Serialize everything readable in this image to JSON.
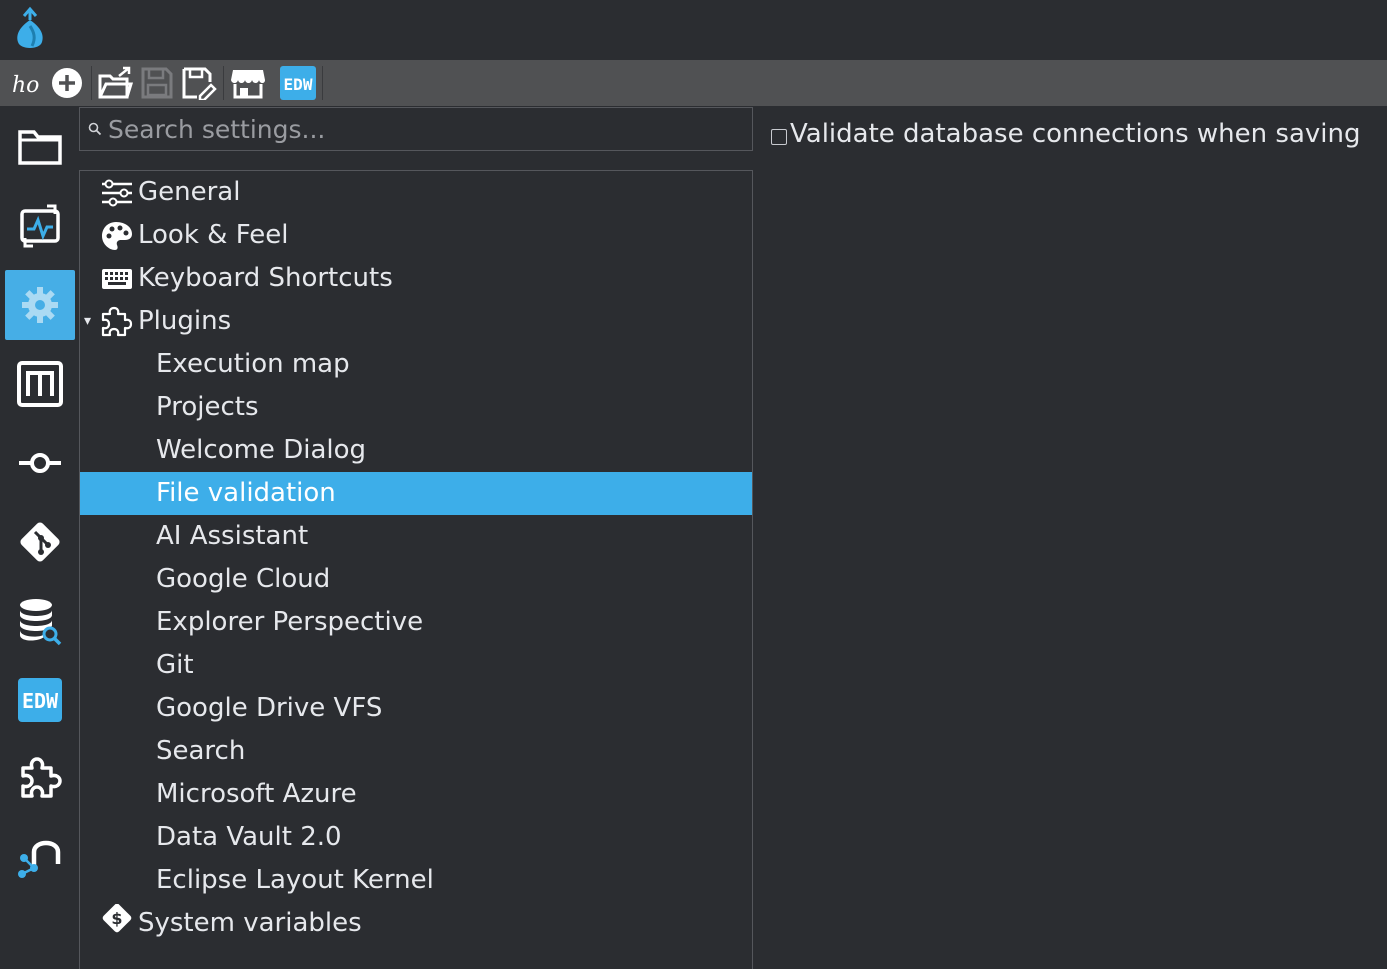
{
  "app": {
    "logo_icon": "hop-logo-icon"
  },
  "toolbar": {
    "buttons": [
      {
        "name": "hop-icon"
      },
      {
        "name": "new-icon"
      },
      {
        "name": "open-file-icon"
      },
      {
        "name": "save-icon"
      },
      {
        "name": "save-as-icon"
      },
      {
        "name": "marketplace-icon"
      },
      {
        "name": "edw-icon",
        "text": "EDW"
      }
    ]
  },
  "sidebar": {
    "items": [
      {
        "name": "file-explorer",
        "icon": "folder-icon"
      },
      {
        "name": "execution-perspective",
        "icon": "execution-chart-icon"
      },
      {
        "name": "configuration",
        "icon": "gear-icon",
        "active": true
      },
      {
        "name": "metadata",
        "icon": "metadata-icon"
      },
      {
        "name": "pipeline",
        "icon": "pipeline-node-icon"
      },
      {
        "name": "git",
        "icon": "git-icon"
      },
      {
        "name": "database-search",
        "icon": "database-search-icon"
      },
      {
        "name": "edw",
        "icon": "edw-icon",
        "text": "EDW"
      },
      {
        "name": "plugins",
        "icon": "puzzle-icon"
      },
      {
        "name": "neo4j",
        "icon": "neo4j-icon"
      }
    ]
  },
  "search": {
    "placeholder": "Search settings...",
    "value": ""
  },
  "tree": {
    "items": [
      {
        "label": "General",
        "icon": "sliders-icon",
        "level": 0
      },
      {
        "label": "Look & Feel",
        "icon": "palette-icon",
        "level": 0
      },
      {
        "label": "Keyboard Shortcuts",
        "icon": "keyboard-icon",
        "level": 0
      },
      {
        "label": "Plugins",
        "icon": "puzzle-icon",
        "level": 0,
        "expanded": true
      },
      {
        "label": "Execution map",
        "level": 1
      },
      {
        "label": "Projects",
        "level": 1
      },
      {
        "label": "Welcome Dialog",
        "level": 1
      },
      {
        "label": "File validation",
        "level": 1,
        "selected": true
      },
      {
        "label": "AI Assistant",
        "level": 1
      },
      {
        "label": "Google Cloud",
        "level": 1
      },
      {
        "label": "Explorer Perspective",
        "level": 1
      },
      {
        "label": "Git",
        "level": 1
      },
      {
        "label": "Google Drive VFS",
        "level": 1
      },
      {
        "label": "Search",
        "level": 1
      },
      {
        "label": "Microsoft Azure",
        "level": 1
      },
      {
        "label": "Data Vault 2.0",
        "level": 1
      },
      {
        "label": "Eclipse Layout Kernel",
        "level": 1
      },
      {
        "label": "System variables",
        "icon": "dollar-diamond-icon",
        "level": 0
      }
    ]
  },
  "settings": {
    "validate_label": "Validate database connections when saving",
    "validate_checked": false
  },
  "colors": {
    "accent": "#3daee9",
    "background": "#2b2d31",
    "toolbar": "#505153"
  }
}
